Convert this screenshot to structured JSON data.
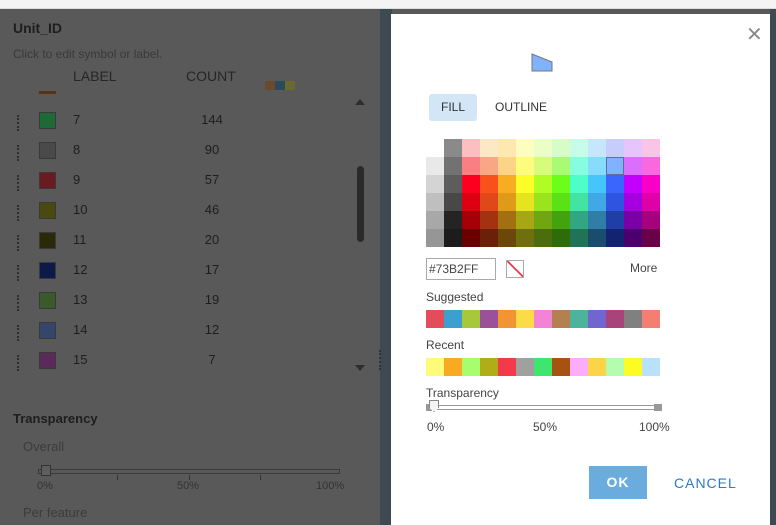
{
  "left_panel": {
    "title": "Unit_ID",
    "hint": "Click to edit symbol or label.",
    "col_label": "LABEL",
    "col_count": "COUNT",
    "ramp_colors": [
      "#6a4a2a",
      "#2b4a5a",
      "#6a6a30"
    ],
    "rows": [
      {
        "label": "7",
        "count": "144",
        "color": "#1c6a38"
      },
      {
        "label": "8",
        "count": "90",
        "color": "#4a4a4a"
      },
      {
        "label": "9",
        "count": "57",
        "color": "#6a1a20"
      },
      {
        "label": "10",
        "count": "46",
        "color": "#4a4a10"
      },
      {
        "label": "11",
        "count": "20",
        "color": "#2a2a08"
      },
      {
        "label": "12",
        "count": "17",
        "color": "#0c1a4a"
      },
      {
        "label": "13",
        "count": "19",
        "color": "#3a5a2a"
      },
      {
        "label": "14",
        "count": "12",
        "color": "#34466a"
      },
      {
        "label": "15",
        "count": "7",
        "color": "#5a2a5a"
      }
    ],
    "transparency": {
      "title": "Transparency",
      "overall": "Overall",
      "per_feature": "Per feature",
      "ticks": [
        "0%",
        "50%",
        "100%"
      ],
      "value_percent": 0
    }
  },
  "dialog": {
    "preview_color": "#80b2ff",
    "tabs": [
      "FILL",
      "OUTLINE"
    ],
    "active_tab": "FILL",
    "palette": [
      [
        "#ffffff",
        "#8a8a8a",
        "#fbbfc2",
        "#fde8c6",
        "#fee8b0",
        "#fefdc0",
        "#eafec5",
        "#d6fdc5",
        "#c7fde8",
        "#c6e6fc",
        "#c5cdfd",
        "#e7c4fd",
        "#fac4e8"
      ],
      [
        "#e9e9e9",
        "#727272",
        "#f97f82",
        "#f9a686",
        "#fbd485",
        "#fdfc7e",
        "#d9fb7b",
        "#a8fb73",
        "#87fde0",
        "#87dcfd",
        "#80b2ff",
        "#dc6efd",
        "#f769dd"
      ],
      [
        "#d4d4d4",
        "#5d5d5d",
        "#fd0020",
        "#f9501c",
        "#f8ac22",
        "#fdfd27",
        "#b0fd24",
        "#6cfd1b",
        "#4efec8",
        "#45c5fc",
        "#3a66fd",
        "#c400fd",
        "#f900c8"
      ],
      [
        "#bfbfbf",
        "#484848",
        "#dd0012",
        "#df4919",
        "#df9a18",
        "#e4e41f",
        "#99e41c",
        "#5ae216",
        "#43e4a3",
        "#40a8e4",
        "#2f54e0",
        "#a600e0",
        "#e000a8"
      ],
      [
        "#a8a8a8",
        "#242424",
        "#a50007",
        "#a43210",
        "#a27010",
        "#a7a716",
        "#70a612",
        "#42a30f",
        "#30a682",
        "#2e7ea6",
        "#1f3fa6",
        "#7a00a6",
        "#a5007d"
      ],
      [
        "#969696",
        "#1c1c1c",
        "#6b0000",
        "#6b200a",
        "#6b480a",
        "#6f6f0d",
        "#4b6d0b",
        "#2d6c09",
        "#207355",
        "#1a4c6d",
        "#142272",
        "#4a006e",
        "#6a0048"
      ]
    ],
    "hex_value": "#73B2FF",
    "more": "More",
    "suggested_label": "Suggested",
    "suggested": [
      "#e34c59",
      "#3ba0d0",
      "#a8c83c",
      "#9b519a",
      "#f29432",
      "#f9dc46",
      "#f283d5",
      "#b38150",
      "#4eb39b",
      "#7165d1",
      "#a9447a",
      "#808080",
      "#f47e71"
    ],
    "recent_label": "Recent",
    "recent": [
      "#fffb78",
      "#f8aa23",
      "#a8fd6f",
      "#afae17",
      "#f43a4a",
      "#a0a0a0",
      "#3fe56f",
      "#a65210",
      "#fbadfb",
      "#fbd447",
      "#b5fdae",
      "#fcfb23",
      "#b8e2fc"
    ],
    "transparency_label": "Transparency",
    "transparency_ticks": [
      "0%",
      "50%",
      "100%"
    ],
    "transparency_percent": 0,
    "ok": "OK",
    "cancel": "CANCEL"
  }
}
